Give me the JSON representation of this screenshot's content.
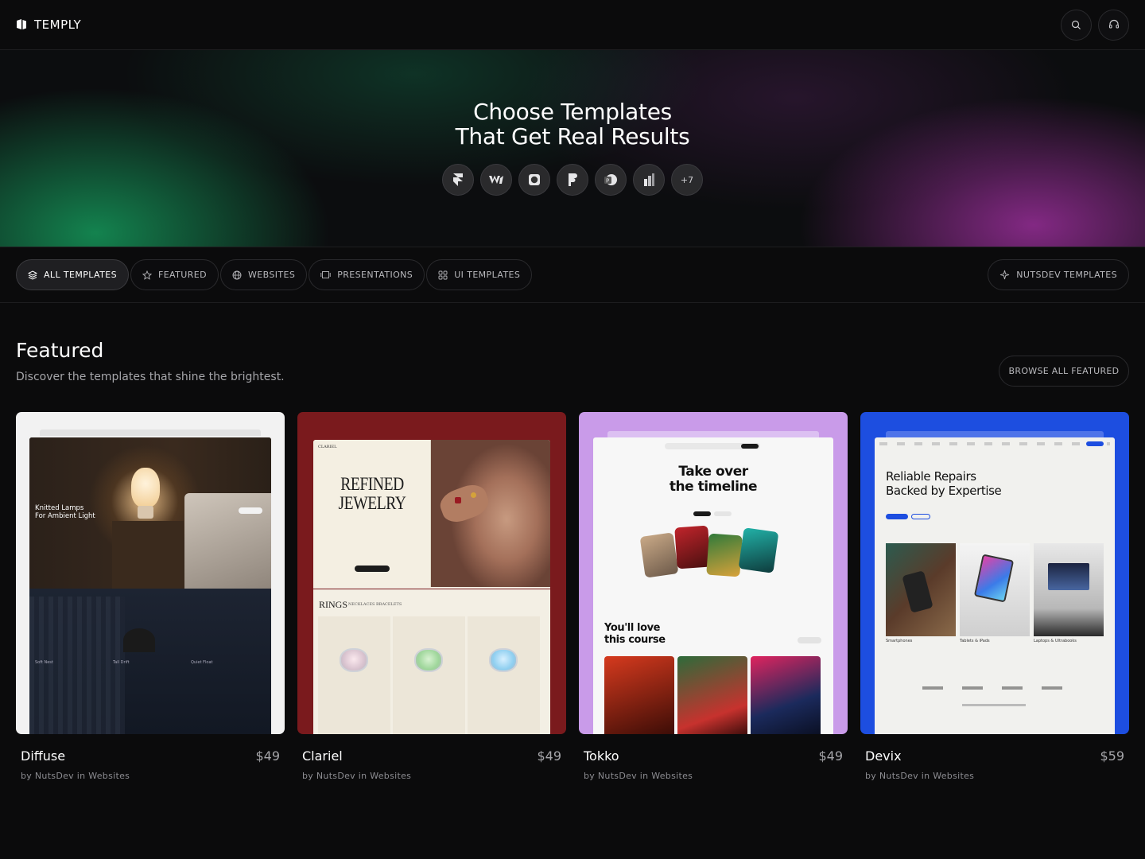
{
  "app": {
    "name": "TEMPLY"
  },
  "hero": {
    "title_line1": "Choose Templates",
    "title_line2": "That Get Real Results",
    "tools_more": "+7"
  },
  "filters": {
    "items": [
      {
        "label": "ALL TEMPLATES"
      },
      {
        "label": "FEATURED"
      },
      {
        "label": "WEBSITES"
      },
      {
        "label": "PRESENTATIONS"
      },
      {
        "label": "UI TEMPLATES"
      }
    ],
    "right": "NUTSDEV TEMPLATES"
  },
  "featured": {
    "title": "Featured",
    "subtitle": "Discover the templates that shine the brightest.",
    "browse": "BROWSE ALL FEATURED"
  },
  "cards": [
    {
      "name": "Diffuse",
      "price": "$49",
      "byline": "by NutsDev in Websites",
      "preview": {
        "headline1": "Knitted Lamps",
        "headline2": "For Ambient Light",
        "labels": [
          "Soft Nest",
          "Tall Drift",
          "Quiet Float"
        ]
      }
    },
    {
      "name": "Clariel",
      "price": "$49",
      "byline": "by NutsDev in Websites",
      "preview": {
        "brand": "CLARIEL",
        "headline1": "REFINED",
        "headline2": "JEWELRY",
        "section": "RINGS",
        "tabs": "NECKLACES  BRACELETS"
      }
    },
    {
      "name": "Tokko",
      "price": "$49",
      "byline": "by NutsDev in Websites",
      "preview": {
        "headline1": "Take over",
        "headline2": "the timeline",
        "sub1": "You'll love",
        "sub2": "this course"
      }
    },
    {
      "name": "Devix",
      "price": "$59",
      "byline": "by NutsDev in Websites",
      "preview": {
        "headline1": "Reliable Repairs",
        "headline2": "Backed by Expertise",
        "cats": [
          "Smartphones",
          "Tablets & iPads",
          "Laptops & Ultrabooks"
        ]
      }
    }
  ],
  "colors": {
    "card1_bg": "#f2f2f2",
    "card2_bg": "#7a1a1d",
    "card3_bg": "#c99be9",
    "card4_bg": "#1d4ee0"
  }
}
